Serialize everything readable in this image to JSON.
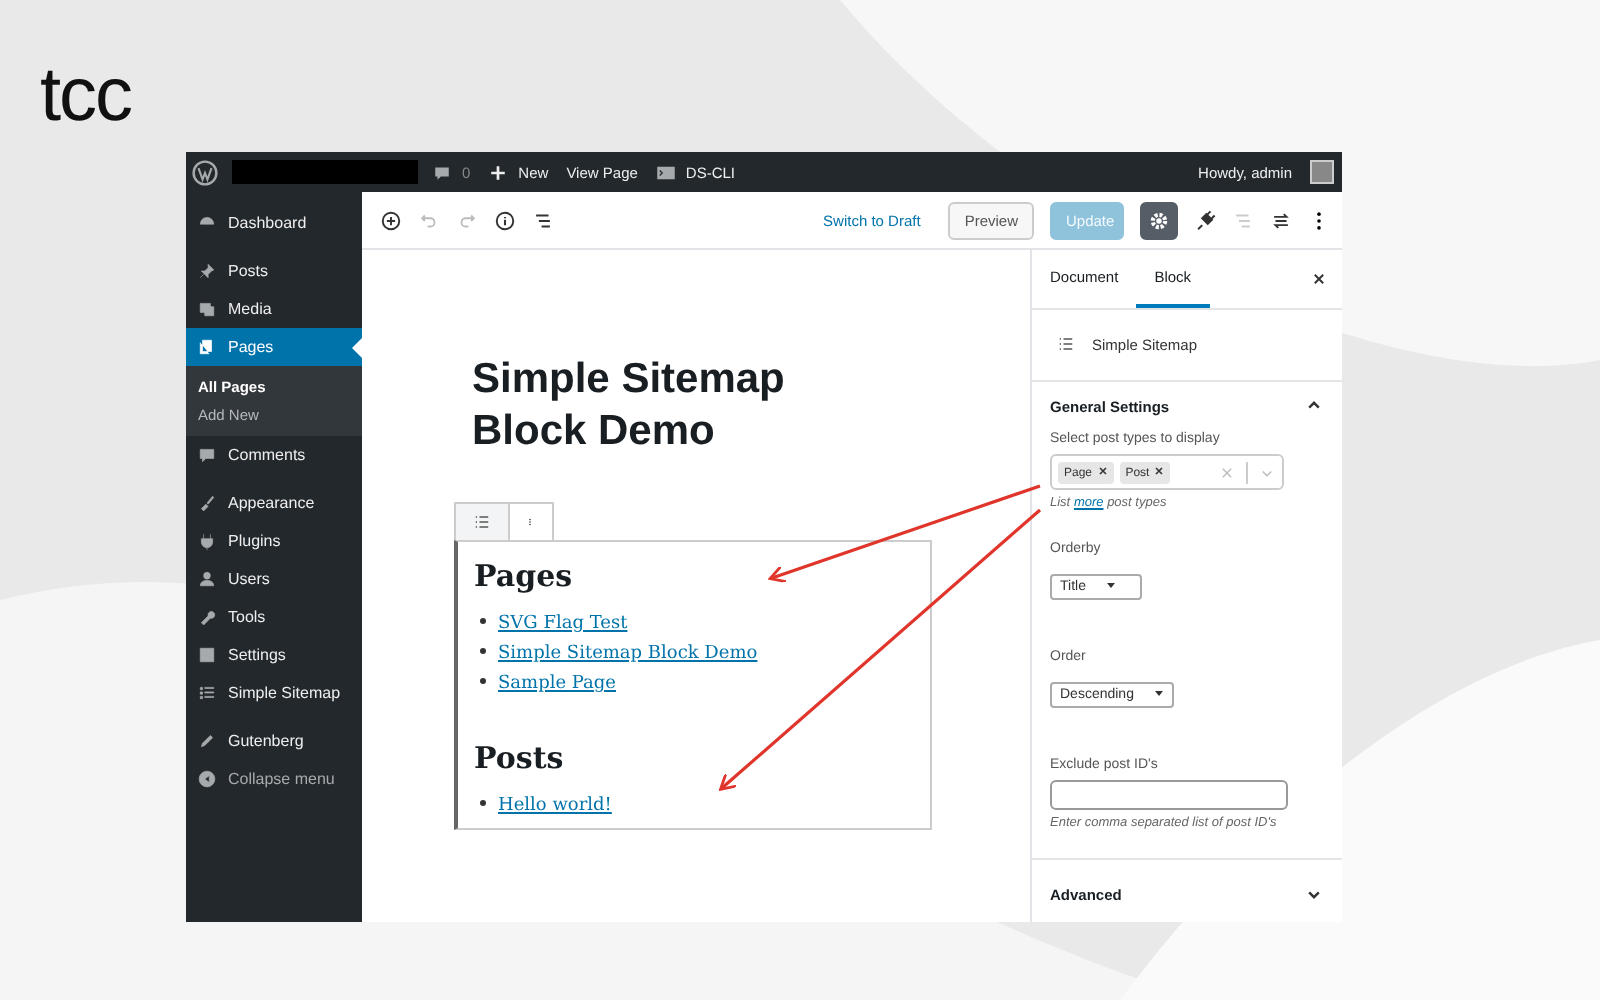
{
  "logo": {
    "text": "tcc"
  },
  "admin_bar": {
    "comments_count": "0",
    "new_label": "New",
    "view_label": "View Page",
    "plugin_label": "DS-CLI",
    "greeting": "Howdy, admin"
  },
  "sidebar": {
    "sections": [
      [
        {
          "label": "Dashboard",
          "kind": "menu",
          "selected": false
        }
      ],
      [
        {
          "label": "Posts",
          "kind": "menu",
          "selected": false
        },
        {
          "label": "Media",
          "kind": "menu",
          "selected": false
        },
        {
          "label": "Pages",
          "kind": "menu",
          "selected": true,
          "children": [
            {
              "label": "All Pages",
              "selected": true
            },
            {
              "label": "Add New",
              "selected": false
            }
          ]
        },
        {
          "label": "Comments",
          "kind": "menu",
          "selected": false
        }
      ],
      [
        {
          "label": "Appearance",
          "kind": "menu",
          "selected": false
        },
        {
          "label": "Plugins",
          "kind": "menu",
          "selected": false
        },
        {
          "label": "Users",
          "kind": "menu",
          "selected": false
        },
        {
          "label": "Tools",
          "kind": "menu",
          "selected": false
        },
        {
          "label": "Settings",
          "kind": "menu",
          "selected": false
        },
        {
          "label": "Simple Sitemap",
          "kind": "menu",
          "selected": false
        }
      ],
      [
        {
          "label": "Gutenberg",
          "kind": "menu",
          "selected": false
        },
        {
          "label": "Collapse menu",
          "kind": "collapse",
          "selected": false
        }
      ]
    ]
  },
  "toolbar": {
    "switch_label": "Switch to Draft",
    "preview_label": "Preview",
    "update": {
      "label": "Update",
      "disabled": true
    },
    "settings_selected": true
  },
  "editor": {
    "title": "Simple Sitemap Block Demo",
    "sections": [
      {
        "heading": "Pages",
        "links": [
          "SVG Flag Test",
          "Simple Sitemap Block Demo",
          "Sample Page"
        ]
      },
      {
        "heading": "Posts",
        "links": [
          "Hello world!"
        ]
      }
    ]
  },
  "settings": {
    "tabs": [
      {
        "label": "Document",
        "selected": false
      },
      {
        "label": "Block",
        "selected": true
      }
    ],
    "block_name": "Simple Sitemap",
    "general": {
      "title": "General Settings",
      "expanded": true,
      "post_types_label": "Select post types to display",
      "post_types": [
        "Page",
        "Post"
      ],
      "help_before": "List",
      "help_link": "more",
      "help_after": "post types",
      "orderby_label": "Orderby",
      "orderby": "Title",
      "order_label": "Order",
      "order": "Descending",
      "exclude_label": "Exclude post ID's",
      "exclude_help": "Enter comma separated list of post ID's"
    },
    "advanced": {
      "title": "Advanced",
      "expanded": false
    }
  }
}
